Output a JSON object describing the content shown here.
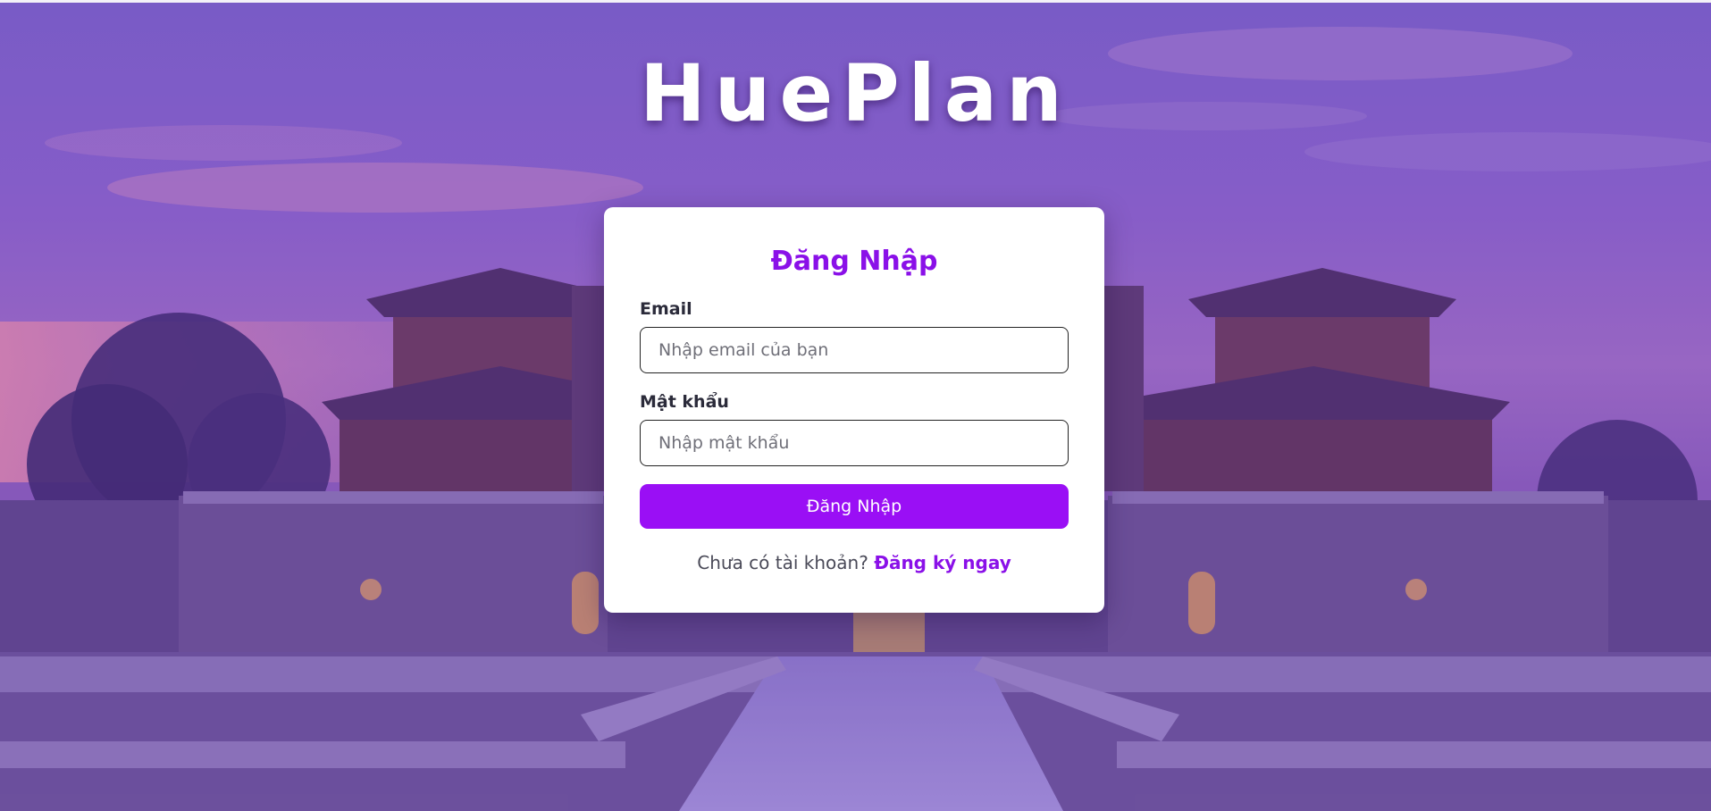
{
  "brand": {
    "title": "HuePlan"
  },
  "login_form": {
    "heading": "Đăng Nhập",
    "email": {
      "label": "Email",
      "placeholder": "Nhập email của bạn",
      "value": ""
    },
    "password": {
      "label": "Mật khẩu",
      "placeholder": "Nhập mật khẩu",
      "value": ""
    },
    "submit_label": "Đăng Nhập",
    "signup_prompt": "Chưa có tài khoản?",
    "signup_link": "Đăng ký ngay"
  },
  "colors": {
    "accent": "#9a0ff5",
    "heading": "#8a10e8",
    "overlay": "#763cc8"
  }
}
